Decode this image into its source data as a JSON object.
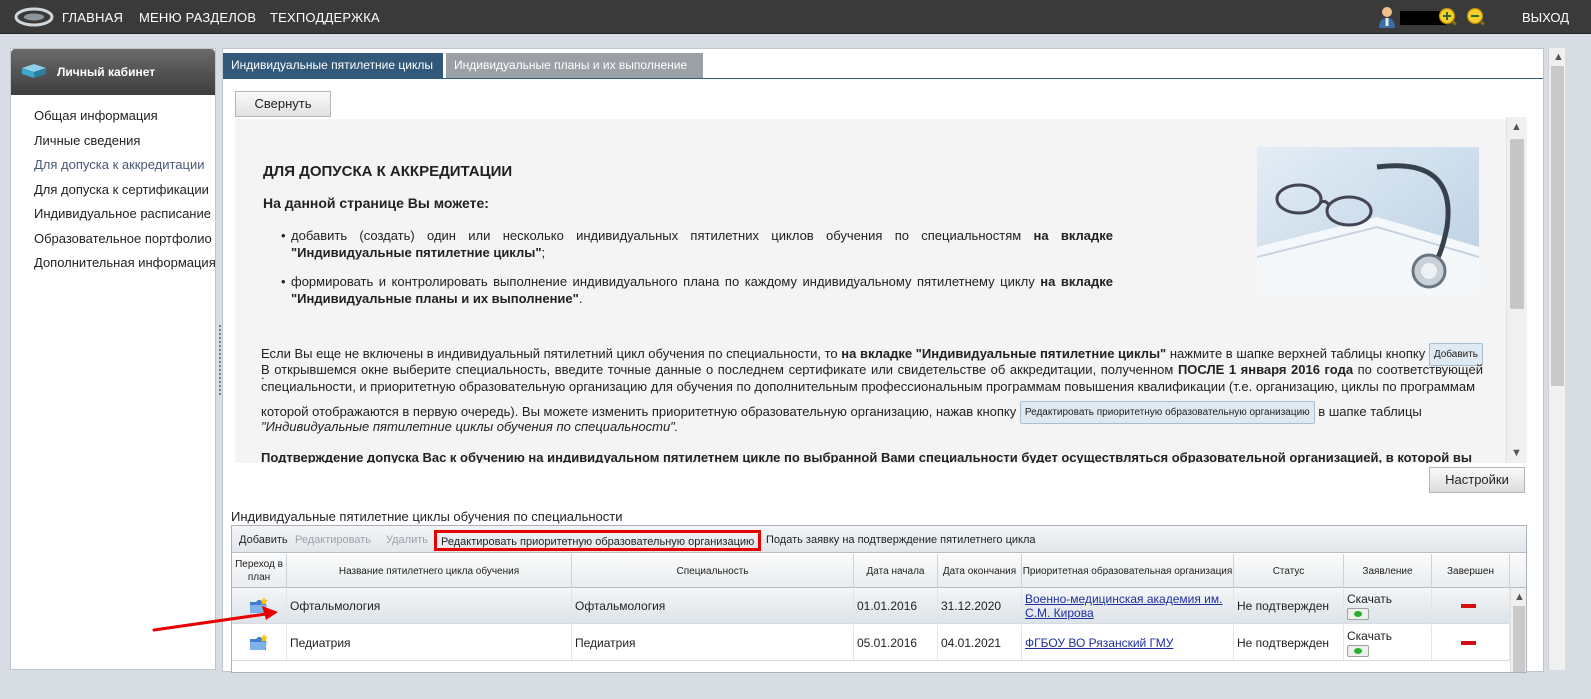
{
  "topbar": {
    "nav": [
      "ГЛАВНАЯ",
      "МЕНЮ РАЗДЕЛОВ",
      "ТЕХПОДДЕРЖКА"
    ],
    "logout": "ВЫХОД",
    "icons": [
      "logo-icon",
      "user-icon",
      "zoom-in-icon",
      "zoom-out-icon"
    ]
  },
  "sidebar": {
    "title": "Личный кабинет",
    "items": [
      {
        "label": "Общая информация"
      },
      {
        "label": "Личные сведения"
      },
      {
        "label": "Для допуска к аккредитации",
        "active": true
      },
      {
        "label": "Для допуска к сертификации"
      },
      {
        "label": "Индивидуальное расписание"
      },
      {
        "label": "Образовательное портфолио"
      },
      {
        "label": "Дополнительная информация"
      }
    ]
  },
  "tabs": [
    "Индивидуальные пятилетние циклы",
    "Индивидуальные планы и их выполнение"
  ],
  "collapse_button": "Свернуть",
  "settings_button": "Настройки",
  "info": {
    "title": "ДЛЯ ДОПУСКА К АККРЕДИТАЦИИ",
    "subtitle": "На данной странице Вы можете:",
    "bullet1": {
      "text": "добавить (создать) один или несколько индивидуальных пятилетних циклов обучения по специальностям ",
      "bold": "на вкладке \"Индивидуальные пятилетние циклы\"",
      "end": ";"
    },
    "bullet2": {
      "text": "формировать и контролировать выполнение индивидуального плана по каждому индивидуальному пятилетнему циклу ",
      "bold": "на вкладке \"Индивидуальные планы и их выполнение\"",
      "end": "."
    },
    "para_line1_a": "Если Вы еще не включены в индивидуальный пятилетний цикл обучения по специальности, то ",
    "para_line1_bold": "на вкладке \"Индивидуальные пятилетние циклы\"",
    "para_line1_b": " нажмите в шапке верхней таблицы кнопку ",
    "add_btn": "Добавить",
    "para_line1_end": ".",
    "para_body_a": "В открывшемся окне выберите специальность, введите точные данные о последнем сертификате или свидетельстве об аккредитации, полученном ",
    "para_body_bold": "ПОСЛЕ 1 января 2016 года",
    "para_body_b": " по соответствующей специальности, и приоритетную образовательную организацию для обучения по дополнительным профессиональным программам повышения квалификации (т.е. организацию, циклы по программам",
    "para_line4_a": "которой отображаются в первую очередь). Вы можете изменить приоритетную образовательную организацию, нажав кнопку ",
    "edit_btn": "Редактировать приоритетную образовательную организацию",
    "para_line4_b": " в шапке таблицы",
    "para_line5": "\"Индивидуальные пятилетние циклы обучения по специальности\".",
    "para_bold": "Подтверждение допуска Вас к обучению на индивидуальном пятилетнем цикле по выбранной Вами специальности будет осуществляться образовательной организацией, в которой вы"
  },
  "grid": {
    "title": "Индивидуальные пятилетние циклы обучения по специальности",
    "toolbar": {
      "add": "Добавить",
      "edit": "Редактировать",
      "delete": "Удалить",
      "edit_org": "Редактировать приоритетную образовательную организацию",
      "submit": "Подать заявку на подтверждение пятилетнего цикла"
    },
    "columns": [
      "Переход в план",
      "Название пятилетнего цикла обучения",
      "Специальность",
      "Дата начала",
      "Дата окончания",
      "Приоритетная образовательная организация",
      "Статус",
      "Заявление",
      "Завершен"
    ],
    "rows": [
      {
        "name": "Офтальмология",
        "specialty": "Офтальмология",
        "start": "01.01.2016",
        "end": "31.12.2020",
        "org": "Военно-медицинская академия им. С.М. Кирова",
        "status": "Не подтвержден",
        "application": "Скачать"
      },
      {
        "name": "Педиатрия",
        "specialty": "Педиатрия",
        "start": "05.01.2016",
        "end": "04.01.2021",
        "org": "ФГБОУ ВО Рязанский ГМУ",
        "status": "Не подтвержден",
        "application": "Скачать"
      }
    ]
  },
  "colors": {
    "tab_active": "#33597a",
    "tab_inactive": "#9aa0a5",
    "highlight": "#e60000",
    "link": "#1f2f9f"
  }
}
